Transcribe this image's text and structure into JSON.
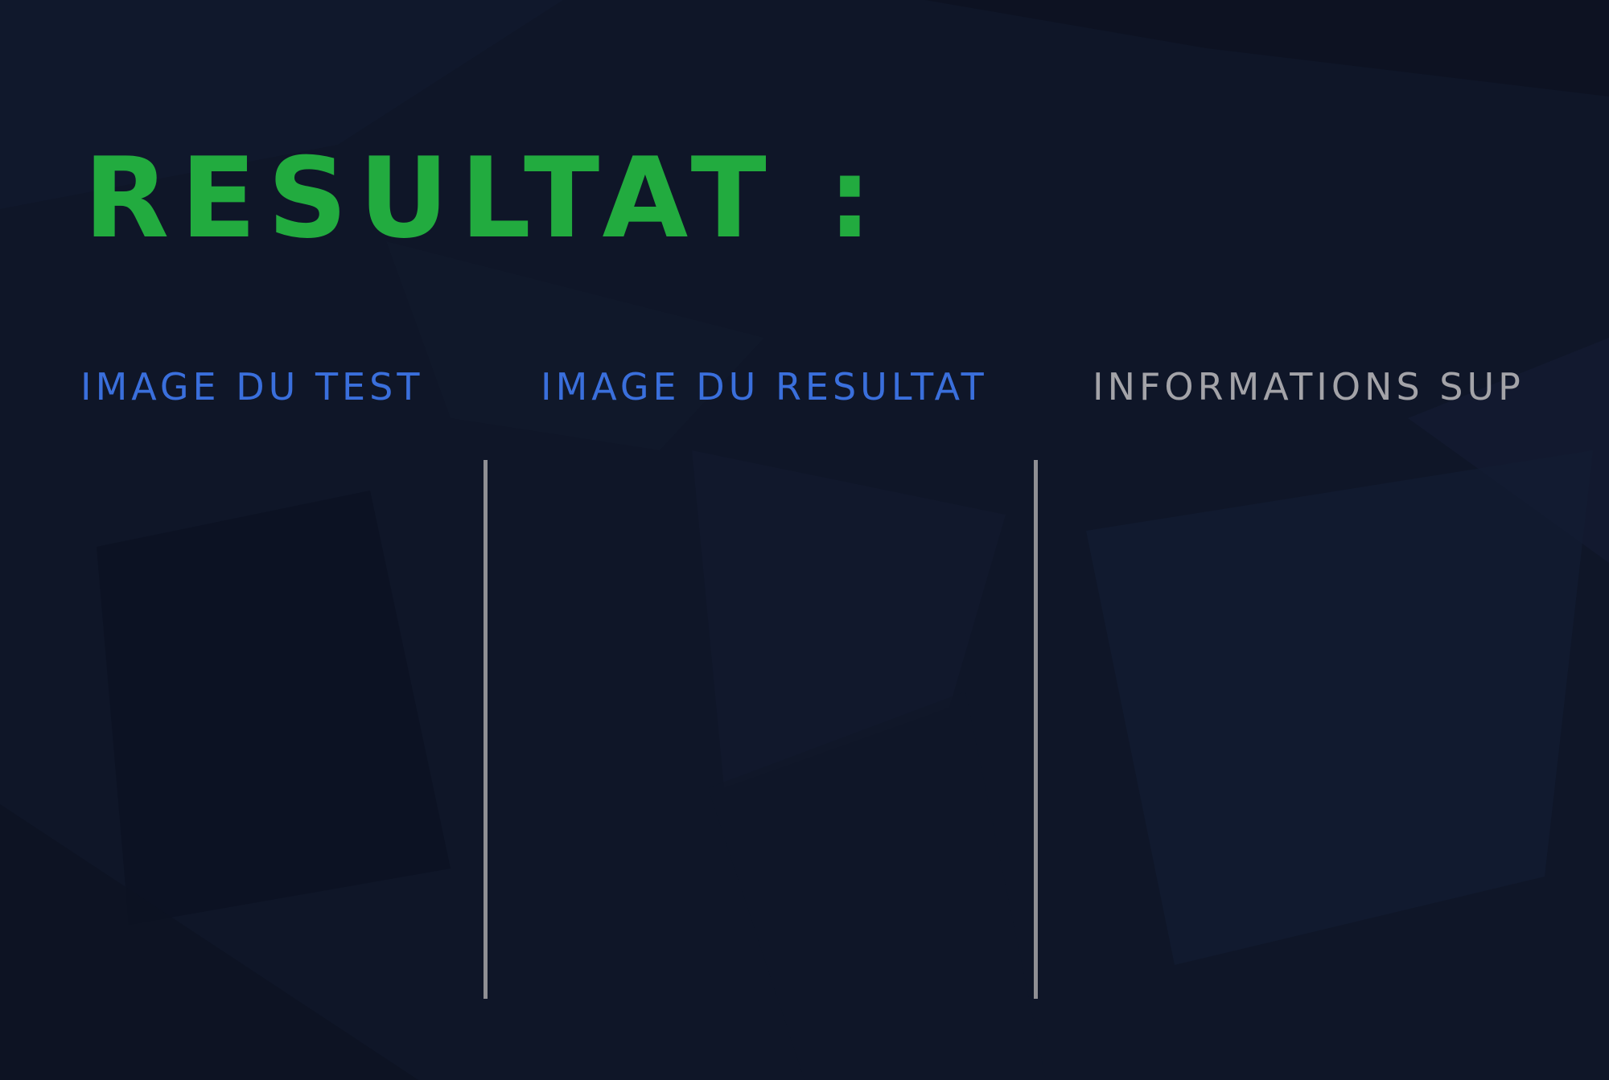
{
  "page": {
    "title": "Resultat :",
    "title_color": "#22ab3f",
    "background_color": "#0f1628"
  },
  "columns": [
    {
      "heading": "Image du test",
      "color": "#3a6fdc"
    },
    {
      "heading": "Image du resultat",
      "color": "#3a6fdc"
    },
    {
      "heading": "Informations sup",
      "color": "#a3a3a8"
    }
  ]
}
